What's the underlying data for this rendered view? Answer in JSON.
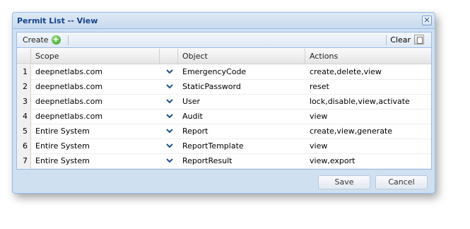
{
  "window": {
    "title": "Permit List -- View",
    "close_glyph": "✕"
  },
  "toolbar": {
    "create_label": "Create",
    "create_icon": "plus-icon",
    "clear_label": "Clear",
    "clear_icon": "clear-icon"
  },
  "grid": {
    "columns": [
      "Scope",
      "",
      "Object",
      "Actions"
    ],
    "rows": [
      {
        "num": "1",
        "scope": "deepnetlabs.com",
        "object": "EmergencyCode",
        "actions": "create,delete,view"
      },
      {
        "num": "2",
        "scope": "deepnetlabs.com",
        "object": "StaticPassword",
        "actions": "reset"
      },
      {
        "num": "3",
        "scope": "deepnetlabs.com",
        "object": "User",
        "actions": "lock,disable,view,activate"
      },
      {
        "num": "4",
        "scope": "deepnetlabs.com",
        "object": "Audit",
        "actions": "view"
      },
      {
        "num": "5",
        "scope": "Entire System",
        "object": "Report",
        "actions": "create,view,generate"
      },
      {
        "num": "6",
        "scope": "Entire System",
        "object": "ReportTemplate",
        "actions": "view"
      },
      {
        "num": "7",
        "scope": "Entire System",
        "object": "ReportResult",
        "actions": "view,export"
      }
    ]
  },
  "footer": {
    "save_label": "Save",
    "cancel_label": "Cancel"
  }
}
